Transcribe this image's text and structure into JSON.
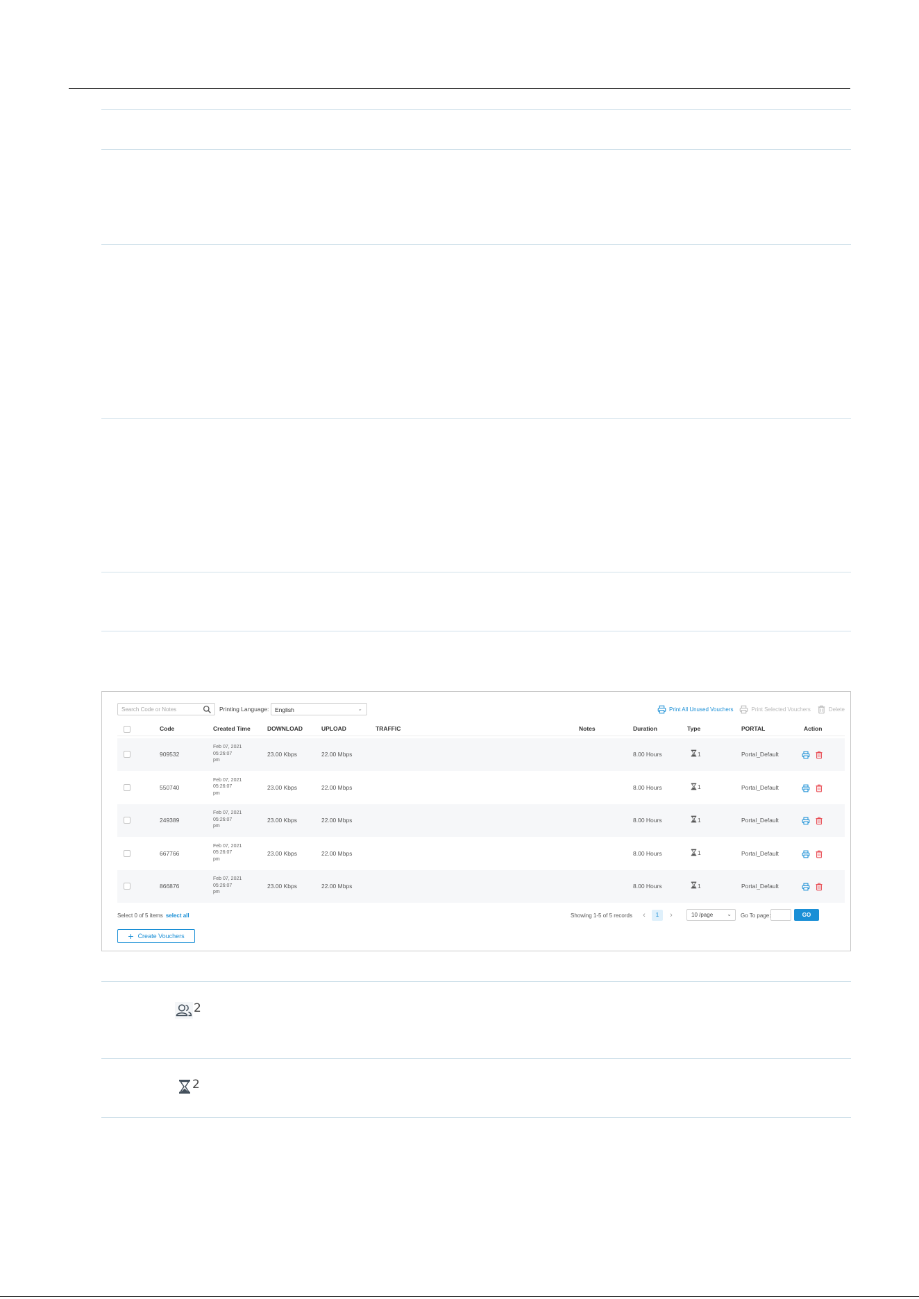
{
  "toolbar": {
    "search_placeholder": "Search Code or Notes",
    "printing_language_label": "Printing Language:",
    "printing_language_value": "English",
    "print_all_unused": "Print All Unused Vouchers",
    "print_selected": "Print Selected Vouchers",
    "delete": "Delete"
  },
  "table": {
    "headers": {
      "code": "Code",
      "created_time": "Created Time",
      "download": "DOWNLOAD",
      "upload": "UPLOAD",
      "traffic": "TRAFFIC",
      "notes": "Notes",
      "duration": "Duration",
      "type": "Type",
      "portal": "PORTAL",
      "action": "Action"
    },
    "rows": [
      {
        "code": "909532",
        "created_line1": "Feb 07, 2021",
        "created_line2": "05:26:07",
        "created_line3": "pm",
        "download": "23.00 Kbps",
        "upload": "22.00 Mbps",
        "duration": "8.00 Hours",
        "type_count": "1",
        "portal": "Portal_Default"
      },
      {
        "code": "550740",
        "created_line1": "Feb 07, 2021",
        "created_line2": "05:26:07",
        "created_line3": "pm",
        "download": "23.00 Kbps",
        "upload": "22.00 Mbps",
        "duration": "8.00 Hours",
        "type_count": "1",
        "portal": "Portal_Default"
      },
      {
        "code": "249389",
        "created_line1": "Feb 07, 2021",
        "created_line2": "05:26:07",
        "created_line3": "pm",
        "download": "23.00 Kbps",
        "upload": "22.00 Mbps",
        "duration": "8.00 Hours",
        "type_count": "1",
        "portal": "Portal_Default"
      },
      {
        "code": "667766",
        "created_line1": "Feb 07, 2021",
        "created_line2": "05:26:07",
        "created_line3": "pm",
        "download": "23.00 Kbps",
        "upload": "22.00 Mbps",
        "duration": "8.00 Hours",
        "type_count": "1",
        "portal": "Portal_Default"
      },
      {
        "code": "866876",
        "created_line1": "Feb 07, 2021",
        "created_line2": "05:26:07",
        "created_line3": "pm",
        "download": "23.00 Kbps",
        "upload": "22.00 Mbps",
        "duration": "8.00 Hours",
        "type_count": "1",
        "portal": "Portal_Default"
      }
    ]
  },
  "footer": {
    "selection_text": "Select 0 of 5 items",
    "select_all": "select all",
    "showing": "Showing 1-5 of 5 records",
    "prev": "‹",
    "current_page": "1",
    "next": "›",
    "per_page": "10 /page",
    "goto_label": "Go To page:",
    "go_button": "GO"
  },
  "create_button": "Create Vouchers",
  "badges": {
    "users_count": "2",
    "hourglass_count": "2"
  },
  "colors": {
    "accent": "#1a8fd6",
    "delete_red": "#e8434b",
    "disabled_grey": "#b8b8b8"
  }
}
